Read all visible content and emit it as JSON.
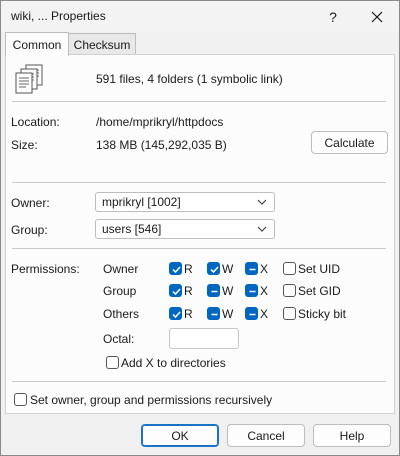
{
  "window": {
    "title": "wiki, ... Properties",
    "help_glyph": "?",
    "close_glyph": "✕"
  },
  "tabs": [
    {
      "label": "Common",
      "active": true
    },
    {
      "label": "Checksum",
      "active": false
    }
  ],
  "summary": {
    "icon": "files-icon",
    "text": "591 files, 4 folders (1 symbolic link)"
  },
  "info": {
    "location_label": "Location:",
    "location_value": "/home/mprikryl/httpdocs",
    "size_label": "Size:",
    "size_value": "138 MB (145,292,035 B)",
    "calculate_label": "Calculate"
  },
  "ownership": {
    "owner_label": "Owner:",
    "owner_value": "mprikryl [1002]",
    "group_label": "Group:",
    "group_value": "users [546]"
  },
  "permissions": {
    "label": "Permissions:",
    "rows": [
      {
        "name": "Owner",
        "r": "checked",
        "w": "checked",
        "x": "indeterminate",
        "special_label": "Set UID",
        "special": "unchecked"
      },
      {
        "name": "Group",
        "r": "checked",
        "w": "indeterminate",
        "x": "indeterminate",
        "special_label": "Set GID",
        "special": "unchecked"
      },
      {
        "name": "Others",
        "r": "checked",
        "w": "indeterminate",
        "x": "indeterminate",
        "special_label": "Sticky bit",
        "special": "unchecked"
      }
    ],
    "r_label": "R",
    "w_label": "W",
    "x_label": "X",
    "octal_label": "Octal:",
    "octal_value": "",
    "add_x_label": "Add X to directories",
    "add_x": "unchecked"
  },
  "recursive": {
    "label": "Set owner, group and permissions recursively",
    "state": "unchecked"
  },
  "footer": {
    "ok_label": "OK",
    "cancel_label": "Cancel",
    "help_label": "Help"
  },
  "colors": {
    "accent": "#0067c0",
    "default_button_border": "#1a73c9"
  }
}
